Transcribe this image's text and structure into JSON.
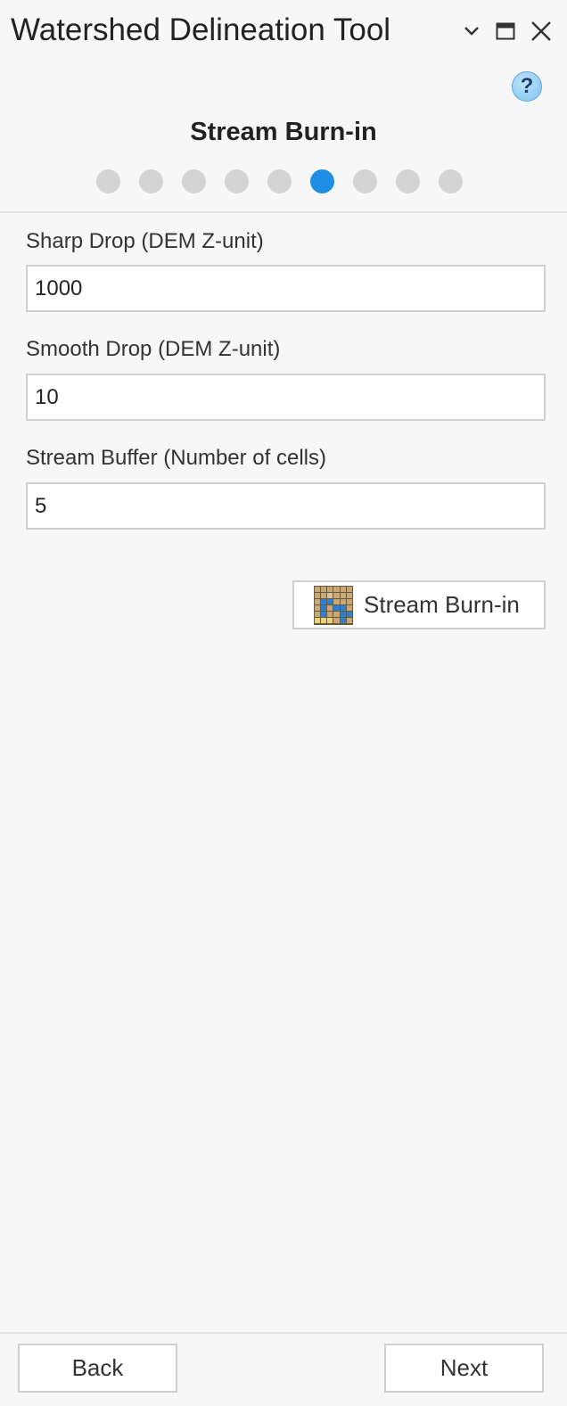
{
  "window": {
    "title": "Watershed Delineation Tool"
  },
  "icons": {
    "dropdown": "chevron-down-icon",
    "maximize": "maximize-icon",
    "close": "close-icon",
    "help": "help-icon",
    "raster": "raster-grid-icon",
    "help_glyph": "?"
  },
  "wizard": {
    "step_title": "Stream Burn-in",
    "total_steps": 9,
    "current_step": 6
  },
  "form": {
    "sharp_drop": {
      "label": "Sharp Drop (DEM Z-unit)",
      "value": "1000"
    },
    "smooth_drop": {
      "label": "Smooth Drop (DEM Z-unit)",
      "value": "10"
    },
    "stream_buffer": {
      "label": "Stream Buffer (Number of cells)",
      "value": "5"
    }
  },
  "actions": {
    "burn_in_label": "Stream Burn-in"
  },
  "footer": {
    "back_label": "Back",
    "next_label": "Next"
  },
  "colors": {
    "accent": "#1e8ee5",
    "inactive_dot": "#d4d4d4",
    "background": "#f7f7f7"
  }
}
